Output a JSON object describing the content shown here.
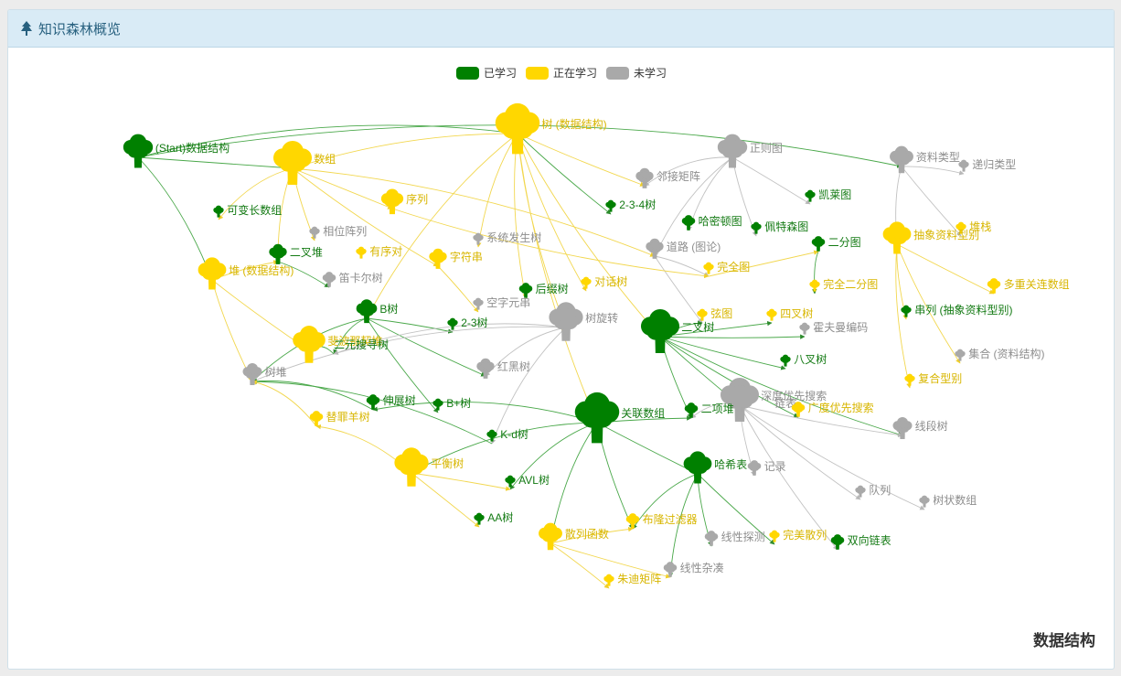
{
  "header": {
    "title": "知识森林概览",
    "icon": "tree-icon"
  },
  "corner_label": "数据结构",
  "colors": {
    "learned": "#008000",
    "learning": "#ffd700",
    "unlearned": "#a9a9a9"
  },
  "legend": [
    {
      "key": "learned",
      "label": "已学习"
    },
    {
      "key": "learning",
      "label": "正在学习"
    },
    {
      "key": "unlearned",
      "label": "未学习"
    }
  ],
  "nodes": [
    {
      "id": "start",
      "label": "(Start)数据结构",
      "status": "learned"
    },
    {
      "id": "tree",
      "label": "树 (数据结构)",
      "status": "learning"
    },
    {
      "id": "array",
      "label": "数组",
      "status": "learning"
    },
    {
      "id": "regular_graph",
      "label": "正则图",
      "status": "unlearned"
    },
    {
      "id": "data_type",
      "label": "资料类型",
      "status": "unlearned"
    },
    {
      "id": "recursive_type",
      "label": "递归类型",
      "status": "unlearned"
    },
    {
      "id": "adj_matrix",
      "label": "邻接矩阵",
      "status": "unlearned"
    },
    {
      "id": "kaley",
      "label": "凯莱图",
      "status": "learned"
    },
    {
      "id": "t234",
      "label": "2-3-4树",
      "status": "learned"
    },
    {
      "id": "var_array",
      "label": "可变长数组",
      "status": "learned"
    },
    {
      "id": "sequence",
      "label": "序列",
      "status": "learning"
    },
    {
      "id": "hamilton",
      "label": "哈密顿图",
      "status": "learned"
    },
    {
      "id": "petersen",
      "label": "佩特森图",
      "status": "learned"
    },
    {
      "id": "stack",
      "label": "堆栈",
      "status": "learning"
    },
    {
      "id": "adt",
      "label": "抽象资料型别",
      "status": "learning"
    },
    {
      "id": "phase_array",
      "label": "相位阵列",
      "status": "unlearned"
    },
    {
      "id": "syntax_tree",
      "label": "系统发生树",
      "status": "unlearned"
    },
    {
      "id": "path_graph",
      "label": "道路 (图论)",
      "status": "unlearned"
    },
    {
      "id": "bipartite",
      "label": "二分图",
      "status": "learned"
    },
    {
      "id": "binary_heap",
      "label": "二叉堆",
      "status": "learned"
    },
    {
      "id": "ordered_pair",
      "label": "有序对",
      "status": "learning"
    },
    {
      "id": "string",
      "label": "字符串",
      "status": "learning"
    },
    {
      "id": "heap",
      "label": "堆 (数据结构)",
      "status": "learning"
    },
    {
      "id": "complete_graph",
      "label": "完全图",
      "status": "learning"
    },
    {
      "id": "multimap",
      "label": "多重关连数组",
      "status": "learning"
    },
    {
      "id": "cartesian",
      "label": "笛卡尔树",
      "status": "unlearned"
    },
    {
      "id": "suffix_tree",
      "label": "后缀树",
      "status": "learned"
    },
    {
      "id": "dialog_tree",
      "label": "对话树",
      "status": "learning"
    },
    {
      "id": "complete_bipartite",
      "label": "完全二分图",
      "status": "learning"
    },
    {
      "id": "empty_string",
      "label": "空字元串",
      "status": "unlearned"
    },
    {
      "id": "sequence_adt",
      "label": "串列 (抽象资料型别)",
      "status": "learned"
    },
    {
      "id": "btree",
      "label": "B树",
      "status": "learned"
    },
    {
      "id": "tree_rotation",
      "label": "树旋转",
      "status": "unlearned"
    },
    {
      "id": "binary_tree",
      "label": "二叉树",
      "status": "learned"
    },
    {
      "id": "path",
      "label": "弦图",
      "status": "learning"
    },
    {
      "id": "quad_tree",
      "label": "四叉树",
      "status": "learning"
    },
    {
      "id": "fibonacci_heap",
      "label": "斐波那契堆",
      "status": "learning"
    },
    {
      "id": "t23",
      "label": "2-3树",
      "status": "learned"
    },
    {
      "id": "huffman",
      "label": "霍夫曼编码",
      "status": "unlearned"
    },
    {
      "id": "bst",
      "label": "二元搜寻树",
      "status": "learned"
    },
    {
      "id": "set_ds",
      "label": "集合 (资料结构)",
      "status": "unlearned"
    },
    {
      "id": "octree",
      "label": "八叉树",
      "status": "learned"
    },
    {
      "id": "heap_tree",
      "label": "树堆",
      "status": "unlearned"
    },
    {
      "id": "rb_tree",
      "label": "红黑树",
      "status": "unlearned"
    },
    {
      "id": "dfs",
      "label": "深度优先搜索",
      "status": "unlearned"
    },
    {
      "id": "linked_list",
      "label": "链表",
      "status": "unlearned"
    },
    {
      "id": "bfs",
      "label": "广度优先搜索",
      "status": "learning"
    },
    {
      "id": "compound_type",
      "label": "复合型别",
      "status": "learning"
    },
    {
      "id": "splay",
      "label": "伸展树",
      "status": "learned"
    },
    {
      "id": "bplus",
      "label": "B+树",
      "status": "learned"
    },
    {
      "id": "assoc_array",
      "label": "关联数组",
      "status": "learned"
    },
    {
      "id": "binomial_heap",
      "label": "二项堆",
      "status": "learned"
    },
    {
      "id": "segment_tree",
      "label": "线段树",
      "status": "unlearned"
    },
    {
      "id": "treap",
      "label": "替罪羊树",
      "status": "learning"
    },
    {
      "id": "kd_tree",
      "label": "K-d树",
      "status": "learned"
    },
    {
      "id": "hash_table",
      "label": "哈希表",
      "status": "learned"
    },
    {
      "id": "record",
      "label": "记录",
      "status": "unlearned"
    },
    {
      "id": "balanced_tree",
      "label": "平衡树",
      "status": "learning"
    },
    {
      "id": "avl",
      "label": "AVL树",
      "status": "learned"
    },
    {
      "id": "queue",
      "label": "队列",
      "status": "unlearned"
    },
    {
      "id": "fenwick",
      "label": "树状数组",
      "status": "unlearned"
    },
    {
      "id": "aa_tree",
      "label": "AA树",
      "status": "learned"
    },
    {
      "id": "bloom",
      "label": "布隆过滤器",
      "status": "learning"
    },
    {
      "id": "hash_fn",
      "label": "散列函数",
      "status": "learning"
    },
    {
      "id": "linear_probe",
      "label": "线性探测",
      "status": "unlearned"
    },
    {
      "id": "perfect_hash",
      "label": "完美散列",
      "status": "learning"
    },
    {
      "id": "doubly_linked",
      "label": "双向链表",
      "status": "learned"
    },
    {
      "id": "linear_chain",
      "label": "线性杂凑",
      "status": "unlearned"
    },
    {
      "id": "sparse_matrix",
      "label": "朱迪矩阵",
      "status": "learning"
    }
  ]
}
